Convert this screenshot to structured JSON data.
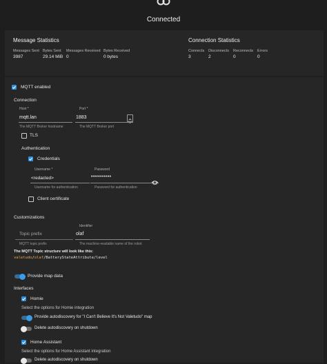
{
  "header": {
    "status": "Connected"
  },
  "message_statistics": {
    "title": "Message Statistics",
    "columns": [
      {
        "label": "Messages Sent",
        "value": "3987"
      },
      {
        "label": "Bytes Sent",
        "value": "29.14 MiB"
      },
      {
        "label": "Messages Received",
        "value": "0"
      },
      {
        "label": "Bytes Received",
        "value": "0 bytes"
      }
    ]
  },
  "connection_statistics": {
    "title": "Connection Statistics",
    "columns": [
      {
        "label": "Connects",
        "value": "3"
      },
      {
        "label": "Disconnects",
        "value": "2"
      },
      {
        "label": "Reconnects",
        "value": "0"
      },
      {
        "label": "Errors",
        "value": "0"
      }
    ]
  },
  "mqtt_enabled": {
    "label": "MQTT enabled",
    "checked": true
  },
  "connection": {
    "title": "Connection",
    "host": {
      "label": "Host *",
      "value": "mqtt.lan",
      "hint": "The MQTT Broker hostname"
    },
    "port": {
      "label": "Port *",
      "value": "1883",
      "hint": "The MQTT Broker port"
    },
    "tls": {
      "label": "TLS",
      "checked": false
    }
  },
  "authentication": {
    "title": "Authentication",
    "credentials": {
      "label": "Credentials",
      "checked": true
    },
    "username": {
      "label": "Username *",
      "value": "<redacted>",
      "hint": "Username for authentication"
    },
    "password": {
      "label": "Password",
      "value": "••••••••••",
      "hint": "Password for authentication"
    },
    "client_certificate": {
      "label": "Client certificate",
      "checked": false
    }
  },
  "customizations": {
    "title": "Customizations",
    "topic_prefix": {
      "placeholder": "Topic prefix",
      "value": "",
      "hint": "MQTT topic prefix"
    },
    "identifier": {
      "label": "Identifier",
      "value": "olaf",
      "hint": "The machine-readable name of the robot"
    },
    "structure_title": "The MQTT Topic structure will look like this:",
    "structure_parts": [
      "valetudo",
      "/",
      "olaf",
      "/BatteryStateAttribute/level"
    ]
  },
  "provide_map_data": {
    "label": "Provide map data",
    "on": true
  },
  "interfaces": {
    "title": "Interfaces",
    "homie": {
      "label": "Homie",
      "checked": true,
      "description": "Select the options for Homie integration",
      "autodiscovery": {
        "label": "Provide autodiscovery for \"I Can't Believe It's Not Valetudo\" map",
        "on": true
      },
      "delete_on_shutdown": {
        "label": "Delete autodiscovery on shutdown",
        "on": false
      }
    },
    "home_assistant": {
      "label": "Home Assistant",
      "checked": true,
      "description": "Select the options for Home Assistant integration",
      "delete_on_shutdown": {
        "label": "Delete autodiscovery on shutdown",
        "on": false
      }
    }
  },
  "colors": {
    "accent": "#2d8fdc",
    "background": "#1e1e1e",
    "panel": "#262626"
  }
}
